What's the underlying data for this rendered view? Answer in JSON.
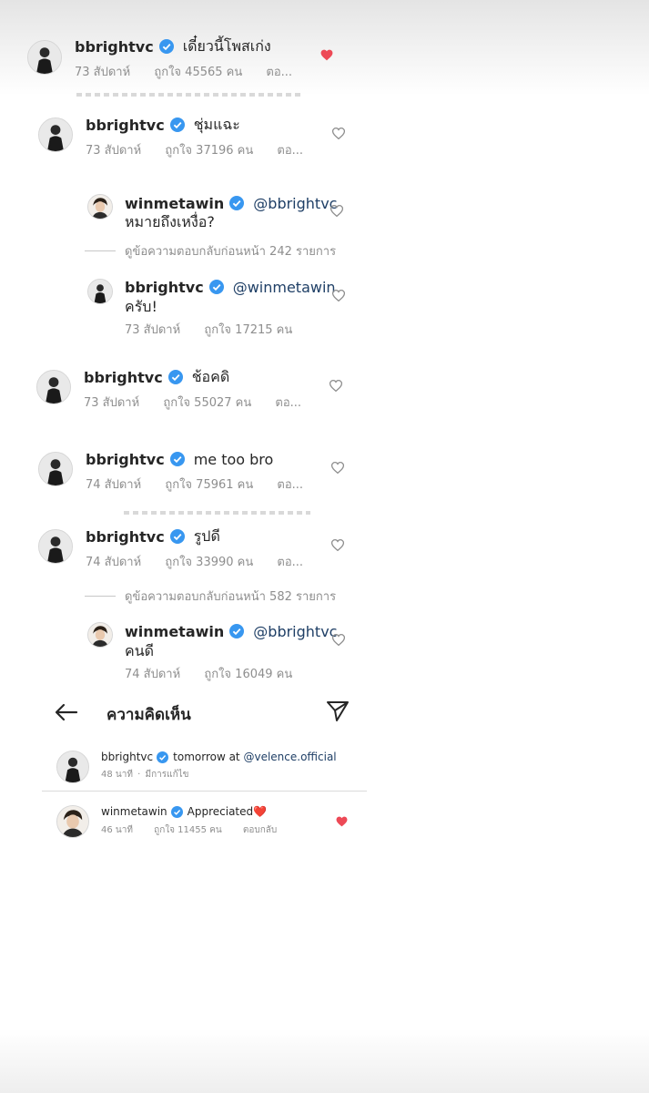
{
  "comments": [
    {
      "user": "bbrightvc",
      "text": "เดี๋ยวนี้โพสเก่ง",
      "mention": "",
      "time": "73 สัปดาห์",
      "likes": "ถูกใจ 45565 คน",
      "reply": "ตอ...",
      "liked": true
    },
    {
      "user": "bbrightvc",
      "text": "ชุ่มแฉะ",
      "mention": "",
      "time": "73 สัปดาห์",
      "likes": "ถูกใจ 37196 คน",
      "reply": "ตอ...",
      "liked": false
    },
    {
      "user": "winmetawin",
      "mention": "@bbrightvc",
      "text": "หมายถึงเหงื่อ?",
      "time": "",
      "likes": "",
      "reply": "",
      "liked": false
    },
    {
      "user": "bbrightvc",
      "mention": "@winmetawin",
      "text": "ครับ!",
      "time": "73 สัปดาห์",
      "likes": "ถูกใจ 17215 คน",
      "reply": "",
      "liked": false
    },
    {
      "user": "bbrightvc",
      "text": "ช้อคดิ",
      "mention": "",
      "time": "73 สัปดาห์",
      "likes": "ถูกใจ 55027 คน",
      "reply": "ตอ...",
      "liked": false
    },
    {
      "user": "bbrightvc",
      "text": "me too bro",
      "mention": "",
      "time": "74 สัปดาห์",
      "likes": "ถูกใจ 75961 คน",
      "reply": "ตอ...",
      "liked": false
    },
    {
      "user": "bbrightvc",
      "text": "รูปดี",
      "mention": "",
      "time": "74 สัปดาห์",
      "likes": "ถูกใจ 33990 คน",
      "reply": "ตอ...",
      "liked": false
    },
    {
      "user": "winmetawin",
      "mention": "@bbrightvc",
      "text": "คนดี",
      "time": "74 สัปดาห์",
      "likes": "ถูกใจ 16049 คน",
      "reply": "",
      "liked": false
    }
  ],
  "view_replies": [
    "ดูข้อความตอบกลับก่อนหน้า 242 รายการ",
    "ดูข้อความตอบกลับก่อนหน้า 582 รายการ"
  ],
  "panel": {
    "title": "ความคิดเห็น",
    "caption": {
      "user": "bbrightvc",
      "text": "tomorrow at ",
      "mention": "@velence.official",
      "time": "48 นาที",
      "edited": "มีการแก้ไข",
      "separator": "·"
    },
    "reply": {
      "user": "winmetawin",
      "text": "Appreciated❤️",
      "time": "46 นาที",
      "likes": "ถูกใจ 11455 คน",
      "reply": "ตอบกลับ",
      "liked": true
    }
  },
  "icons": {
    "verified": "verified-badge-icon",
    "heart": "heart-icon",
    "back": "back-arrow-icon",
    "send": "send-icon"
  },
  "colors": {
    "verified": "#3897f0",
    "liked_heart": "#ed4956",
    "mention": "#1f3f66",
    "meta": "#8e8e8e"
  }
}
